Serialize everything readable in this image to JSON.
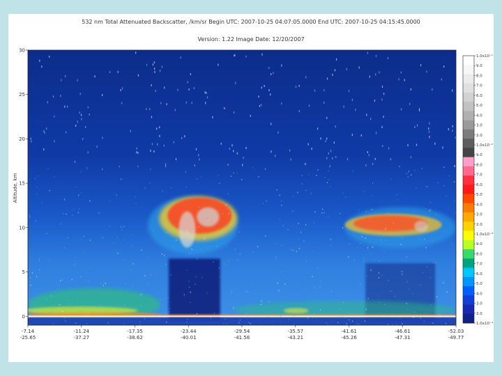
{
  "title": {
    "line1": "532 nm Total Attenuated Backscatter, /km/sr     Begin UTC: 2007-10-25 04:07:05.0000     End UTC: 2007-10-25 04:15:45.0000",
    "line2": "Version: 1.22  Image Date: 12/20/2007"
  },
  "chart_data": {
    "type": "heatmap",
    "ylabel": "Altitude, km",
    "ylim": [
      -1,
      30
    ],
    "y_ticks": [
      0,
      5,
      10,
      15,
      20,
      25,
      30
    ],
    "x_ticks": [
      {
        "lat": "-7.14",
        "lon": "-25.65"
      },
      {
        "lat": "-11.24",
        "lon": "-37.27"
      },
      {
        "lat": "-17.35",
        "lon": "-38.62"
      },
      {
        "lat": "-23.44",
        "lon": "-40.01"
      },
      {
        "lat": "-29.54",
        "lon": "-41.56"
      },
      {
        "lat": "-35.57",
        "lon": "-43.21"
      },
      {
        "lat": "-41.61",
        "lon": "-45.26"
      },
      {
        "lat": "-46.61",
        "lon": "-47.31"
      },
      {
        "lat": "-52.03",
        "lon": "-49.77"
      }
    ],
    "colorbar": {
      "labels": [
        "1.0x10⁻¹",
        "9.0",
        "8.0",
        "7.0",
        "6.0",
        "5.0",
        "4.0",
        "3.0",
        "2.0",
        "1.0x10⁻²",
        "9.0",
        "8.0",
        "7.0",
        "6.0",
        "5.0",
        "4.0",
        "3.0",
        "2.0",
        "1.0x10⁻³",
        "9.0",
        "8.0",
        "7.0",
        "6.0",
        "5.0",
        "4.0",
        "3.0",
        "2.0",
        "1.0x10⁻⁴"
      ],
      "colors": [
        "#ffffff",
        "#f6f6f6",
        "#ececec",
        "#e0e0e0",
        "#d2d2d2",
        "#c2c2c2",
        "#b0b0b0",
        "#9a9a9a",
        "#7d7d7d",
        "#5e5e5e",
        "#454545",
        "#ff9ec8",
        "#ff6a8e",
        "#ff3040",
        "#ff1a1a",
        "#ff4800",
        "#ff7a00",
        "#ffa800",
        "#ffd200",
        "#ffff00",
        "#b8ff2a",
        "#37d96a",
        "#00a57e",
        "#00c8ff",
        "#0096ff",
        "#0060ff",
        "#1040d8",
        "#1828b0",
        "#102088"
      ]
    },
    "features": [
      {
        "name": "surface-return",
        "x_range": [
          0.0,
          1.0
        ],
        "y_range": [
          -0.5,
          0.5
        ]
      },
      {
        "name": "boundary-layer",
        "x_range": [
          0.0,
          0.31
        ],
        "y_range": [
          0.0,
          3.0
        ]
      },
      {
        "name": "high-cloud-left",
        "x_range": [
          0.28,
          0.49
        ],
        "y_range": [
          7.0,
          13.5
        ]
      },
      {
        "name": "high-cloud-right",
        "x_range": [
          0.74,
          1.0
        ],
        "y_range": [
          8.0,
          12.0
        ]
      },
      {
        "name": "low-aerosol-layer",
        "x_range": [
          0.48,
          1.0
        ],
        "y_range": [
          0.0,
          1.5
        ]
      }
    ]
  }
}
